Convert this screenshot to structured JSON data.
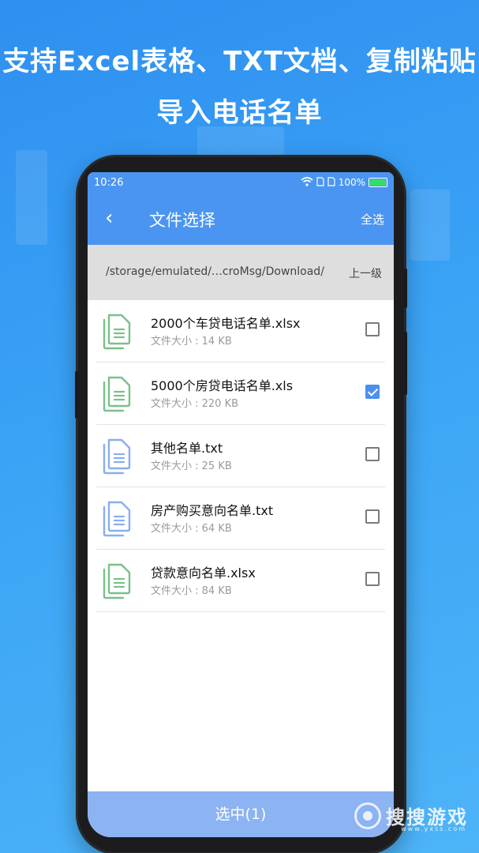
{
  "promo": {
    "line1": "支持Excel表格、TXT文档、复制粘贴",
    "line2": "导入电话名单"
  },
  "status_bar": {
    "time": "10:26",
    "battery": "100%"
  },
  "app_bar": {
    "back": "‹",
    "title": "文件选择",
    "select_all": "全选"
  },
  "path_bar": {
    "path": "/storage/emulated/…croMsg/Download/",
    "up_level": "上一级"
  },
  "files": [
    {
      "name": "2000个车贷电话名单.xlsx",
      "size": "文件大小 : 14 KB",
      "checked": false,
      "type": "xlsx"
    },
    {
      "name": "5000个房贷电话名单.xls",
      "size": "文件大小 : 220 KB",
      "checked": true,
      "type": "xls"
    },
    {
      "name": "其他名单.txt",
      "size": "文件大小 : 25 KB",
      "checked": false,
      "type": "txt"
    },
    {
      "name": "房产购买意向名单.txt",
      "size": "文件大小 : 64 KB",
      "checked": false,
      "type": "txt"
    },
    {
      "name": "贷款意向名单.xlsx",
      "size": "文件大小 : 84 KB",
      "checked": false,
      "type": "xlsx"
    }
  ],
  "bottom_button": {
    "label": "选中(1)"
  },
  "watermark": {
    "text": "搜搜游戏",
    "sub": "www.yxss.com"
  },
  "colors": {
    "accent": "#4b95f2",
    "excel_icon": "#7cc08a",
    "txt_icon": "#8aaef0",
    "bottom_button": "#8cb3f2"
  }
}
